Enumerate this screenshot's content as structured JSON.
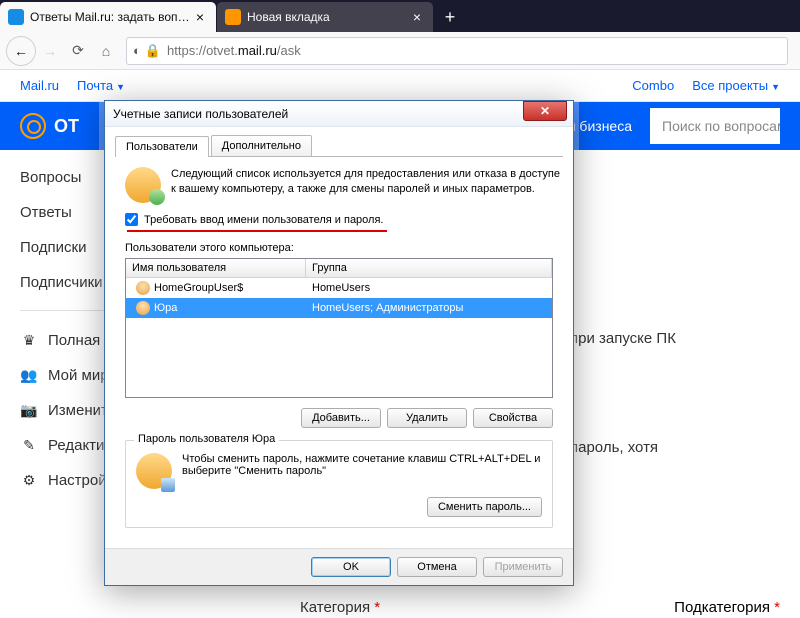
{
  "browser": {
    "tabs": [
      {
        "title": "Ответы Mail.ru: задать вопрос",
        "active": true
      },
      {
        "title": "Новая вкладка",
        "active": false
      }
    ],
    "url_prefix": "https://otvet.",
    "url_domain": "mail.ru",
    "url_suffix": "/ask"
  },
  "mailru": {
    "topnav": {
      "mail": "Mail.ru",
      "pochta": "Почта",
      "combo": "Combo",
      "projects": "Все проекты"
    },
    "logo": "ОТ",
    "business": "Для бизнеса",
    "search_placeholder": "Поиск по вопросам"
  },
  "sidebar": {
    "items": [
      "Вопросы",
      "Ответы",
      "Подписки",
      "Подписчики"
    ],
    "items2": [
      "Полная версия",
      "Мой мир",
      "Изменить анкету",
      "Редактировать профиль",
      "Настройки"
    ]
  },
  "fragments": {
    "a": "при запуске ПК",
    "b": "пароль, хотя",
    "c": "Категория",
    "d": "Подкатегория"
  },
  "dialog": {
    "title": "Учетные записи пользователей",
    "tabs": {
      "users": "Пользователи",
      "advanced": "Дополнительно"
    },
    "intro": "Следующий список используется для предоставления или отказа в доступе к вашему компьютеру, а также для смены паролей и иных параметров.",
    "require_login": "Требовать ввод имени пользователя и пароля.",
    "users_of": "Пользователи этого компьютера:",
    "col_user": "Имя пользователя",
    "col_group": "Группа",
    "rows": [
      {
        "name": "HomeGroupUser$",
        "group": "HomeUsers",
        "selected": false
      },
      {
        "name": "Юра",
        "group": "HomeUsers; Администраторы",
        "selected": true
      }
    ],
    "btn_add": "Добавить...",
    "btn_del": "Удалить",
    "btn_prop": "Свойства",
    "pw_legend": "Пароль пользователя Юра",
    "pw_text": "Чтобы сменить пароль, нажмите сочетание клавиш CTRL+ALT+DEL и выберите \"Сменить пароль\"",
    "btn_pw": "Сменить пароль...",
    "btn_ok": "OK",
    "btn_cancel": "Отмена",
    "btn_apply": "Применить"
  }
}
